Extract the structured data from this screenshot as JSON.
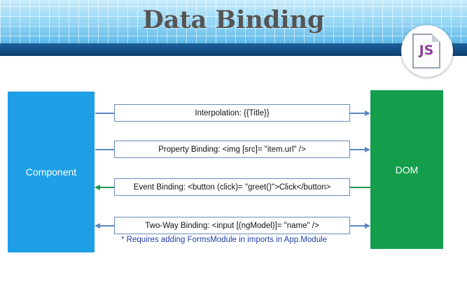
{
  "header": {
    "title": "Data Binding",
    "logo_text": "JS",
    "logo_icon": "js-file-icon"
  },
  "blocks": {
    "component_label": "Component",
    "dom_label": "DOM"
  },
  "bindings": [
    {
      "label": "Interpolation: {{Title}}",
      "direction": "component-to-dom"
    },
    {
      "label": "Property Binding: <img [src]= \"item.url\" />",
      "direction": "component-to-dom"
    },
    {
      "label": "Event Binding: <button (click)= \"greet()\">Click</button>",
      "direction": "dom-to-component"
    },
    {
      "label": "Two-Way Binding: <input [(ngModel)]= \"name\" />",
      "direction": "both"
    }
  ],
  "note": "* Requires adding FormsModule in imports in App.Module",
  "colors": {
    "component": "#1e9fe6",
    "dom": "#149e4c",
    "arrow_blue": "#5b86c5",
    "arrow_green": "#1a9a48"
  }
}
